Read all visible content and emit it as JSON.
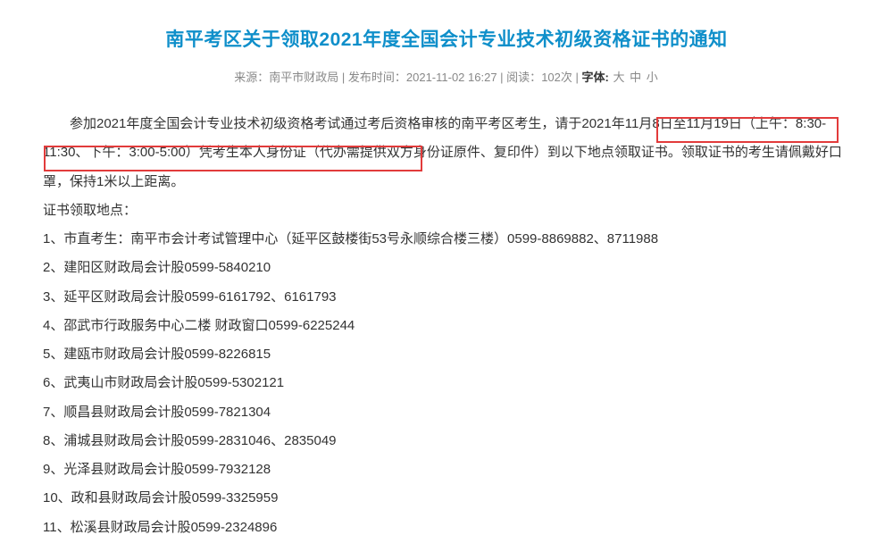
{
  "title": "南平考区关于领取2021年度全国会计专业技术初级资格证书的通知",
  "meta": {
    "source_label": "来源：",
    "source_value": "南平市财政局",
    "sep1": " | ",
    "pubtime_label": "发布时间：",
    "pubtime_value": "2021-11-02 16:27",
    "sep2": " | ",
    "read_label": "阅读：",
    "read_value": "102次",
    "sep3": " | ",
    "font_label": "字体:",
    "font_large": "大",
    "font_medium": "中",
    "font_small": "小"
  },
  "paragraph1_pre": "参加2021年度全国会计专业技术初级资格考试通过考后资格审核的南平考区考生，请于",
  "highlight1": "2021年11月8日至",
  "highlight2": "11月19日（上午：8:30-11:30、下午：3:00-5:00）",
  "paragraph1_post": "凭考生本人身份证（代办需提供双方身份证原件、复印件）到以下地点领取证书。领取证书的考生请佩戴好口罩，保持1米以上距离。",
  "locations_label": "证书领取地点：",
  "locations": [
    "1、市直考生：南平市会计考试管理中心（延平区鼓楼街53号永顺综合楼三楼）0599-8869882、8711988",
    "2、建阳区财政局会计股0599-5840210",
    "3、延平区财政局会计股0599-6161792、6161793",
    "4、邵武市行政服务中心二楼 财政窗口0599-6225244",
    "5、建瓯市财政局会计股0599-8226815",
    "6、武夷山市财政局会计股0599-5302121",
    "7、顺昌县财政局会计股0599-7821304",
    "8、浦城县财政局会计股0599-2831046、2835049",
    "9、光泽县财政局会计股0599-7932128",
    "10、政和县财政局会计股0599-3325959",
    "11、松溪县财政局会计股0599-2324896"
  ]
}
